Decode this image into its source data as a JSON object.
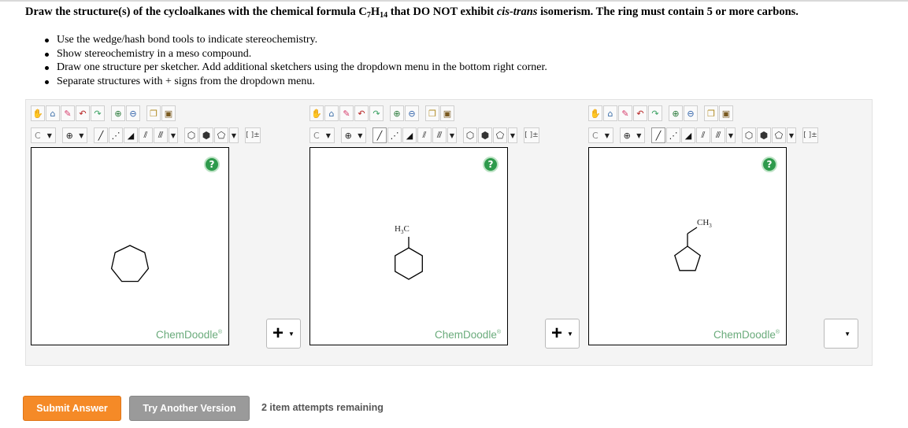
{
  "question": {
    "part1": "Draw the structure(s) of the cycloalkanes with the chemical formula C",
    "sub1": "7",
    "mid": "H",
    "sub2": "14",
    "part2": " that DO NOT exhibit ",
    "italic": "cis-trans",
    "part3": " isomerism. The ring must contain 5 or more carbons."
  },
  "instructions": [
    "Use the wedge/hash bond tools to indicate stereochemistry.",
    "Show stereochemistry in a meso compound.",
    "Draw one structure per sketcher. Add additional sketchers using the dropdown menu in the bottom right corner.",
    "Separate structures with + signs from the dropdown menu."
  ],
  "toolbar": {
    "row1_icons": [
      "hand-icon",
      "erase-icon",
      "pencil-icon",
      "undo-icon",
      "redo-icon",
      "zoom-in-icon",
      "zoom-out-icon",
      "copy-icon",
      "paste-icon"
    ],
    "element_label": "C",
    "atom_chars": "⊕",
    "bracket_label": "[ ]±"
  },
  "sketchers": [
    {
      "id": "sketcher-1",
      "molecule": "cycloheptane",
      "label": ""
    },
    {
      "id": "sketcher-2",
      "molecule": "methylcyclohexane",
      "label": "H3C"
    },
    {
      "id": "sketcher-3",
      "molecule": "methylcyclopentane",
      "label": "CH3"
    }
  ],
  "help_label": "?",
  "brand": {
    "name": "ChemDoodle",
    "mark": "®"
  },
  "separators": [
    {
      "symbol": "+",
      "arrow": "▼"
    },
    {
      "symbol": "+",
      "arrow": "▼"
    },
    {
      "symbol": "",
      "arrow": "▼"
    }
  ],
  "buttons": {
    "submit": "Submit Answer",
    "try_another": "Try Another Version"
  },
  "attempts_text": "2 item attempts remaining",
  "colors": {
    "submit": "#f58a27",
    "try_another": "#9a9a9a",
    "help": "#2e9a4c",
    "brand": "#6aab7b"
  }
}
